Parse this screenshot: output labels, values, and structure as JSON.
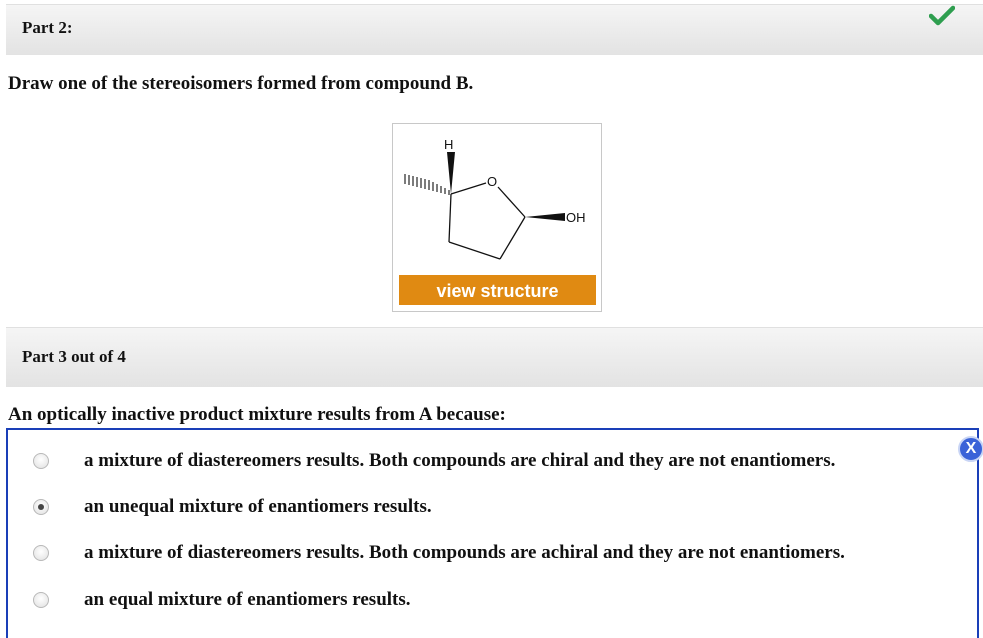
{
  "part2": {
    "title": "Part 2:",
    "prompt": "Draw one of the stereoisomers formed from compound B.",
    "status_icon": "check-icon",
    "status_color": "#2e9e4f",
    "structure": {
      "atom_labels": {
        "h": "H",
        "o": "O",
        "oh": "OH"
      },
      "button_label": "view structure",
      "button_color": "#e08a12"
    }
  },
  "part3": {
    "title": "Part 3 out of 4",
    "prompt": "An optically inactive product mixture results from A because:",
    "options": [
      {
        "label": "a mixture of diastereomers results. Both compounds are chiral and they are not enantiomers.",
        "selected": false
      },
      {
        "label": "an unequal mixture of enantiomers results.",
        "selected": true
      },
      {
        "label": "a mixture of diastereomers results. Both compounds are achiral and they are not enantiomers.",
        "selected": false
      },
      {
        "label": "an equal mixture of enantiomers results.",
        "selected": false
      }
    ],
    "close_icon": "close-icon",
    "close_label": "X",
    "border_color": "#1a3fb8"
  }
}
